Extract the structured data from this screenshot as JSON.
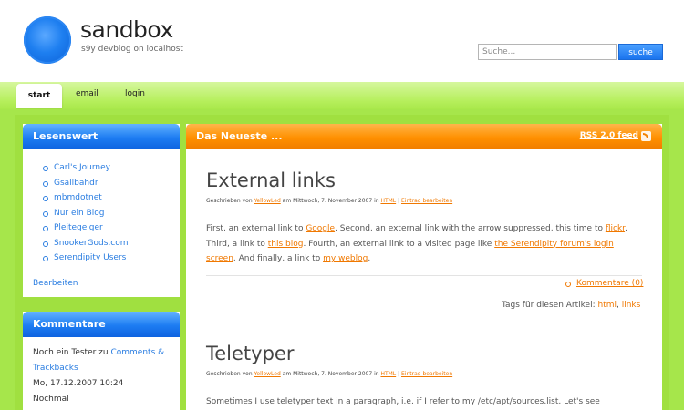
{
  "header": {
    "site_title": "sandbox",
    "site_subtitle": "s9y devblog on localhost",
    "search_placeholder": "Suche...",
    "search_button": "suche"
  },
  "nav": {
    "items": [
      "start",
      "email",
      "login"
    ]
  },
  "sidebar": {
    "lesenswert": {
      "title": "Lesenswert",
      "links": [
        "Carl's Journey",
        "Gsallbahdr",
        "mbmdotnet",
        "Nur ein Blog",
        "Pleitegeiger",
        "SnookerGods.com",
        "Serendipity Users"
      ],
      "edit_label": "Bearbeiten"
    },
    "kommentare": {
      "title": "Kommentare",
      "line1_prefix": "Noch ein Tester zu ",
      "line1_link": "Comments &",
      "line2_link": "Trackbacks",
      "date": "Mo, 17.12.2007 10:24",
      "line4": "Nochmal"
    }
  },
  "main": {
    "section_title": "Das Neueste ...",
    "rss_label": "RSS 2.0 feed",
    "posts": [
      {
        "title": "External links",
        "meta_prefix": "Geschrieben von ",
        "author": "YellowLed",
        "meta_mid": " am Mittwoch, 7. November 2007 in ",
        "category": "HTML",
        "meta_sep": " | ",
        "edit": "Eintrag bearbeiten",
        "body": {
          "t1": "First, an external link to ",
          "l1": "Google",
          "t2": ". Second, an external link with the arrow suppressed, this time to ",
          "l2": "flickr",
          "t3": ". Third, a link to ",
          "l3": "this blog",
          "t4": ". Fourth, an external link to a visited page like ",
          "l4": "the Serendipity forum's login screen",
          "t5": ". And finally, a link to ",
          "l5": "my weblog",
          "t6": "."
        },
        "comments_label": "Kommentare (0)",
        "tags_prefix": "Tags für diesen Artikel: ",
        "tags": [
          "html",
          "links"
        ]
      },
      {
        "title": "Teletyper",
        "meta_prefix": "Geschrieben von ",
        "author": "YellowLed",
        "meta_mid": " am Mittwoch, 7. November 2007 in ",
        "category": "HTML",
        "meta_sep": " | ",
        "edit": "Eintrag bearbeiten",
        "body_text": "Sometimes I use teletyper text in a paragraph, i.e. if I refer to my /etc/apt/sources.list. Let's see"
      }
    ]
  }
}
